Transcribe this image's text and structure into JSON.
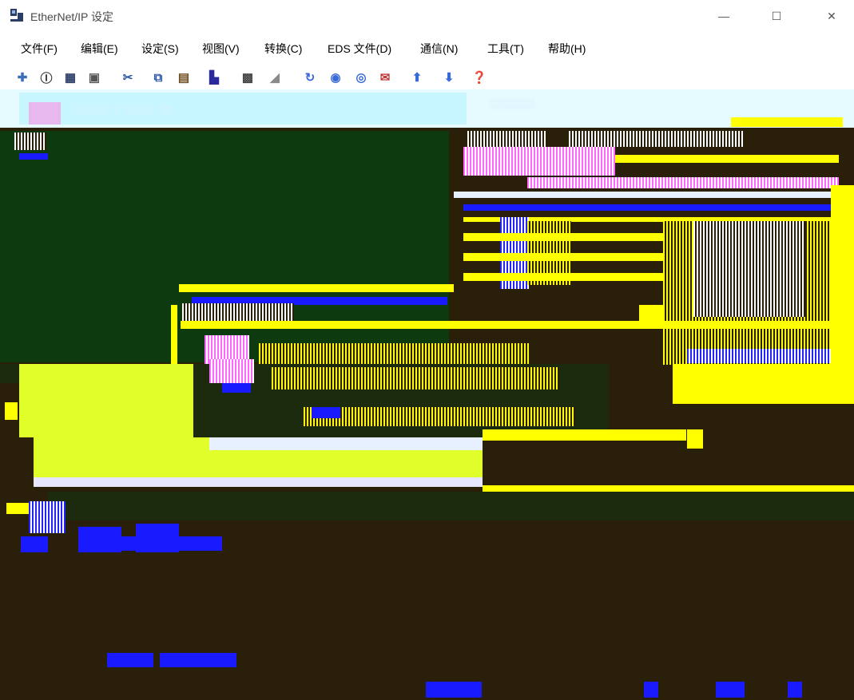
{
  "window": {
    "title": "EtherNet/IP 设定",
    "minimize_glyph": "—",
    "maximize_glyph": "☐",
    "close_glyph": "✕"
  },
  "menu": {
    "items": [
      {
        "label": "文件(F)"
      },
      {
        "label": "编辑(E)"
      },
      {
        "label": "设定(S)"
      },
      {
        "label": "视图(V)"
      },
      {
        "label": "转换(C)"
      },
      {
        "label": "EDS 文件(D)"
      },
      {
        "label": "通信(N)"
      },
      {
        "label": "工具(T)"
      },
      {
        "label": "帮助(H)"
      }
    ]
  },
  "toolbar": {
    "icons": [
      "connect-icon",
      "info-icon",
      "network-icon",
      "copy-window-icon",
      "cut-icon",
      "copy-icon",
      "paste-icon",
      "device-icon",
      "config-icon",
      "edit-icon",
      "refresh-icon",
      "online-icon",
      "offline-icon",
      "mail-icon",
      "upload-icon",
      "download-icon",
      "help-icon"
    ]
  },
  "colors": {
    "glitch_dark": "#2a1f08",
    "glitch_green": "#0e3a10",
    "glitch_yellow": "#ffff00",
    "glitch_lime": "#e0ff2a",
    "glitch_blue": "#1a1aff",
    "glitch_cyan_panel": "#e6fbff"
  }
}
